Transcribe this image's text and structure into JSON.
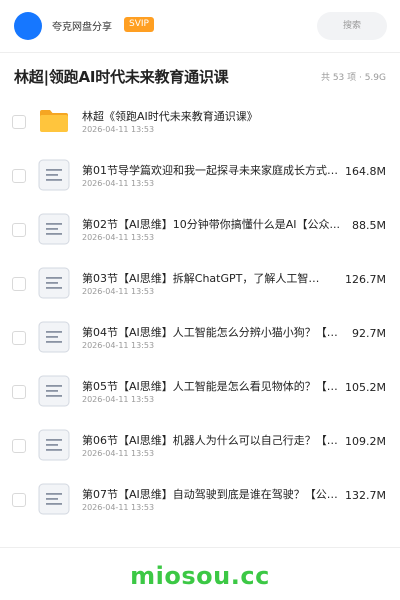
{
  "header": {
    "owner_name": "夸克网盘分享",
    "badge": "SVIP",
    "search_placeholder": "搜索"
  },
  "folder": {
    "title": "林超|领跑AI时代未来教育通识课",
    "meta": "共 53 项 · 5.9G"
  },
  "files": [
    {
      "type": "folder",
      "name": "林超《领跑AI时代未来教育通识课》",
      "date": "2026-04-11 13:53",
      "size": ""
    },
    {
      "type": "doc",
      "name": "第01节导学篇欢迎和我一起探寻未来家庭成长方式【公众号...",
      "date": "2026-04-11 13:53",
      "size": "164.8M"
    },
    {
      "type": "doc",
      "name": "第02节【AI思维】10分钟带你搞懂什么是AI【公众...",
      "date": "2026-04-11 13:53",
      "size": "88.5M"
    },
    {
      "type": "doc",
      "name": "第03节【AI思维】拆解ChatGPT，了解人工智…",
      "date": "2026-04-11 13:53",
      "size": "126.7M"
    },
    {
      "type": "doc",
      "name": "第04节【AI思维】人工智能怎么分辨小猫小狗？【公众号...",
      "date": "2026-04-11 13:53",
      "size": "92.7M"
    },
    {
      "type": "doc",
      "name": "第05节【AI思维】人工智能是怎么看见物体的？【公众号...",
      "date": "2026-04-11 13:53",
      "size": "105.2M"
    },
    {
      "type": "doc",
      "name": "第06节【AI思维】机器人为什么可以自己行走？【公众号...",
      "date": "2026-04-11 13:53",
      "size": "109.2M"
    },
    {
      "type": "doc",
      "name": "第07节【AI思维】自动驾驶到底是谁在驾驶？【公众…",
      "date": "2026-04-11 13:53",
      "size": "132.7M"
    }
  ],
  "watermark": "miosou.cc",
  "colors": {
    "avatar": "#1677ff",
    "badge": "#ff9f22",
    "folder": "#ffc53d",
    "watermark": "#3cc845"
  }
}
